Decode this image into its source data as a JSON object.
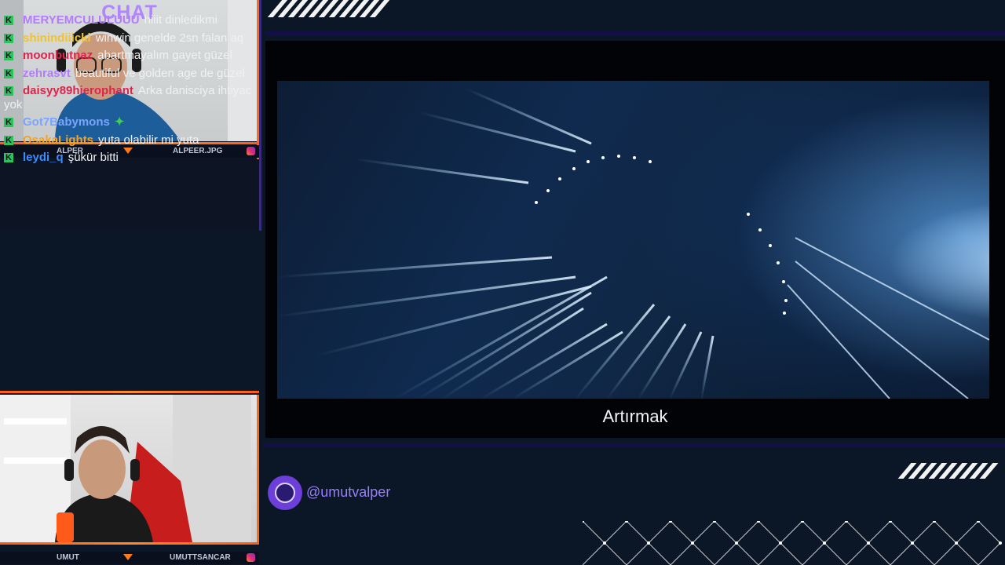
{
  "cams": {
    "top": {
      "name_left": "ALPER",
      "name_right": "ALPEER.JPG"
    },
    "bottom": {
      "name_left": "UMUT",
      "name_right": "UMUTTSANCAR"
    }
  },
  "chat": {
    "title": "CHAT",
    "messages": [
      {
        "user": "MERYEMCULULUUU",
        "text": "hiiit dinledikmi",
        "color": "#b57bff"
      },
      {
        "user": "shinindiiicki",
        "text": "winwin genelde 2sn falan aq",
        "color": "#f2c230"
      },
      {
        "user": "moonbutnaz",
        "text": "abartmayalım gayet güzel",
        "color": "#e0234a"
      },
      {
        "user": "zehrasvt",
        "text": "beautiful ve golden age de güzel",
        "color": "#b57bff"
      },
      {
        "user": "daisyy89hierophant",
        "text": "Arka danisciya ihtiyac yok",
        "color": "#e0234a"
      },
      {
        "user": "Got7Babymons",
        "text": "",
        "color": "#7aa4ff"
      },
      {
        "user": "OsakaLights",
        "text": "yuta olabilir mi yuta",
        "color": "#f2a224"
      },
      {
        "user": "leydi_q",
        "text": "şükür bitti",
        "color": "#3c8cff"
      }
    ]
  },
  "video": {
    "caption": "Artırmak"
  },
  "social": {
    "handle": "@umutvalper",
    "icon": "globe-icon"
  },
  "colors": {
    "accent": "#6b3fd8",
    "cam_border": "#ff6a1a",
    "bar": "#140f48"
  }
}
